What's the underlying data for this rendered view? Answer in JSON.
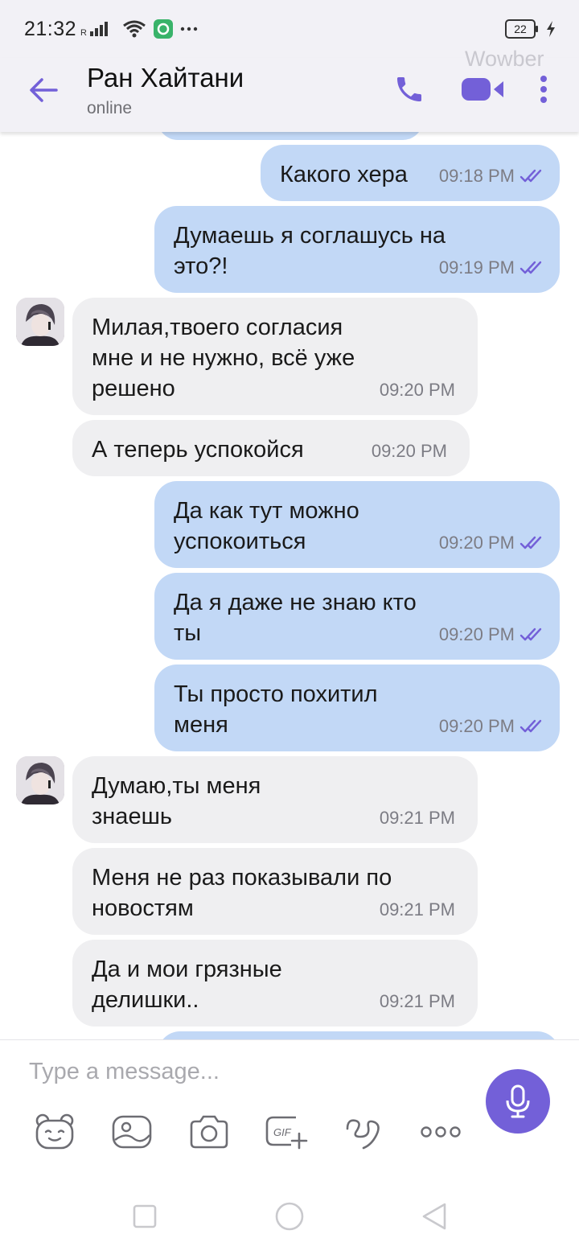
{
  "status_bar": {
    "time": "21:32",
    "battery": "22"
  },
  "header": {
    "contact_name": "Ран Хайтани",
    "status": "online",
    "watermark": "Wowber"
  },
  "messages": [
    {
      "direction": "out",
      "text": "",
      "time": ""
    },
    {
      "direction": "out",
      "text": "Какого хера",
      "time": "09:18 PM"
    },
    {
      "direction": "out",
      "text": "Думаешь я соглашусь на\nэто?!",
      "time": "09:19 PM"
    },
    {
      "direction": "in",
      "text": "Милая,твоего согласия\nмне и не нужно, всё уже\nрешено",
      "time": "09:20 PM"
    },
    {
      "direction": "in",
      "text": "А теперь успокойся",
      "time": "09:20 PM"
    },
    {
      "direction": "out",
      "text": "Да как тут можно\nуспокоиться",
      "time": "09:20 PM"
    },
    {
      "direction": "out",
      "text": "Да я даже не знаю кто\nты",
      "time": "09:20 PM"
    },
    {
      "direction": "out",
      "text": "Ты просто похитил\nменя",
      "time": "09:20 PM"
    },
    {
      "direction": "in",
      "text": "Думаю,ты меня\nзнаешь",
      "time": "09:21 PM"
    },
    {
      "direction": "in",
      "text": "Меня не раз показывали по\nновостям",
      "time": "09:21 PM"
    },
    {
      "direction": "in",
      "text": "Да и мои грязные\nделишки..",
      "time": "09:21 PM"
    }
  ],
  "composer": {
    "placeholder": "Type a message..."
  },
  "colors": {
    "accent": "#7360d8",
    "outgoing_bubble": "#c2d8f6",
    "incoming_bubble": "#efeff1"
  }
}
